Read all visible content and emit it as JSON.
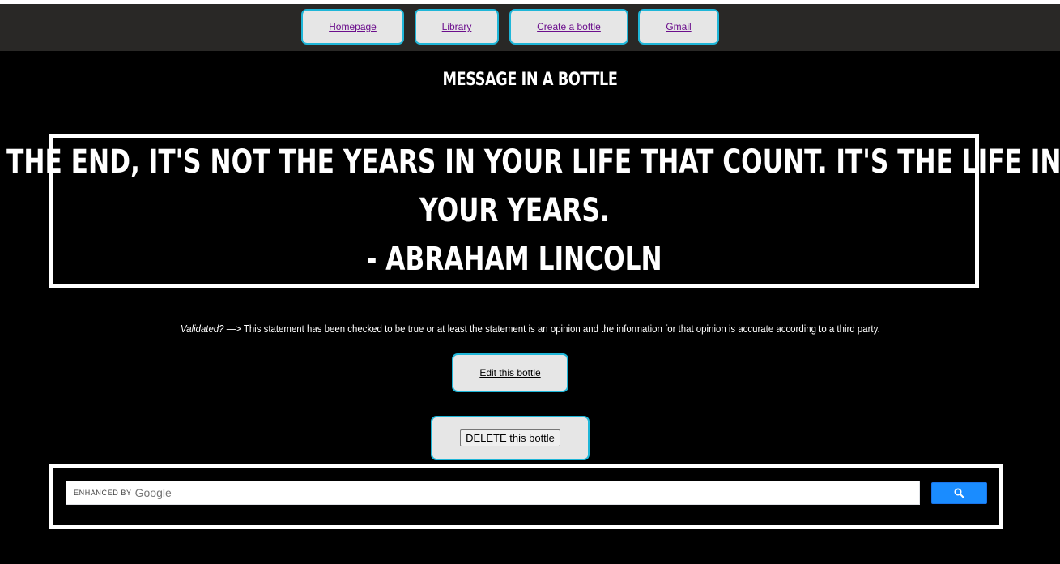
{
  "nav": {
    "items": [
      {
        "label": "Homepage"
      },
      {
        "label": "Library"
      },
      {
        "label": "Create a bottle"
      },
      {
        "label": "Gmail"
      }
    ]
  },
  "page": {
    "title": "MESSAGE IN A BOTTLE"
  },
  "quote": {
    "line1": "IN THE END, IT'S NOT THE YEARS IN YOUR LIFE THAT COUNT. IT'S THE LIFE IN",
    "line2": "YOUR YEARS.",
    "author": "- ABRAHAM LINCOLN"
  },
  "validation": {
    "label": "Validated?",
    "arrow": " —> ",
    "text": "This statement has been checked to be true or at least the statement is an opinion and the information for that opinion is accurate according to a third party."
  },
  "actions": {
    "edit_label": "Edit this bottle",
    "delete_label": "DELETE this bottle"
  },
  "search": {
    "enhanced_label": "ENHANCED BY",
    "brand": "Google",
    "button_icon": "search-icon"
  },
  "colors": {
    "background": "#000000",
    "navbar": "#292826",
    "button_bg": "#e6e6e6",
    "button_border": "#1fb6d8",
    "link": "#6b0e8c",
    "search_button": "#1a8cff"
  }
}
